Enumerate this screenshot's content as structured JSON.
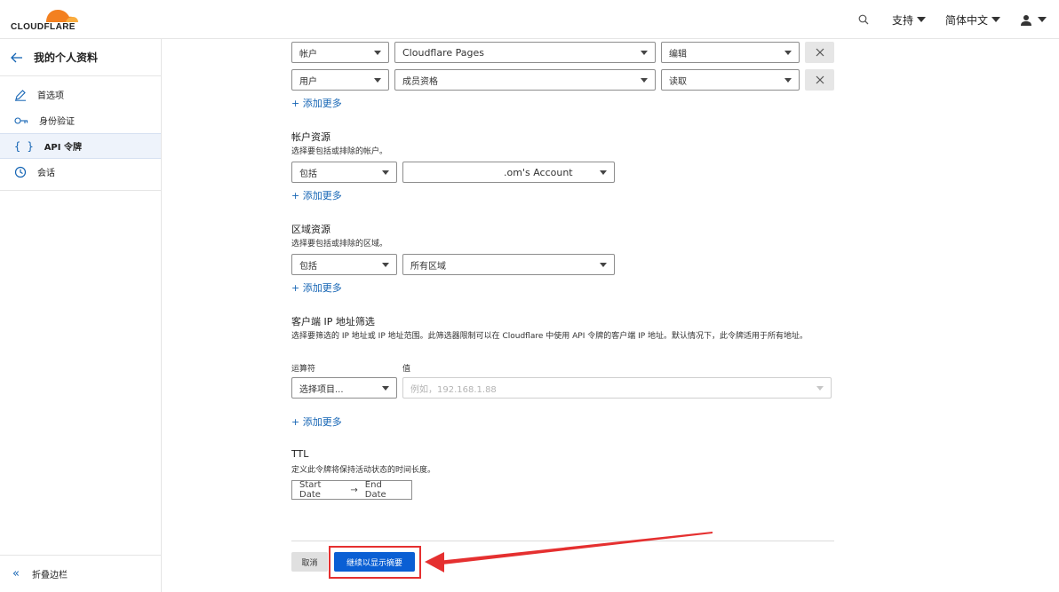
{
  "header": {
    "brand": "CLOUDFLARE",
    "support": "支持",
    "language": "简体中文"
  },
  "sidebar": {
    "title": "我的个人资料",
    "items": [
      {
        "label": "首选项"
      },
      {
        "label": "身份验证"
      },
      {
        "label": "API 令牌"
      },
      {
        "label": "会话"
      }
    ],
    "collapse": "折叠边栏"
  },
  "permissions": {
    "rows": [
      {
        "scope": "帐户",
        "resource": "Cloudflare Pages",
        "level": "编辑"
      },
      {
        "scope": "用户",
        "resource": "成员资格",
        "level": "读取"
      }
    ],
    "add_more": "+ 添加更多"
  },
  "account_resources": {
    "title": "帐户资源",
    "desc": "选择要包括或排除的帐户。",
    "include": "包括",
    "account": ".om's Account",
    "add_more": "+ 添加更多"
  },
  "zone_resources": {
    "title": "区域资源",
    "desc": "选择要包括或排除的区域。",
    "include": "包括",
    "zone": "所有区域",
    "add_more": "+ 添加更多"
  },
  "ip_filter": {
    "title": "客户端 IP 地址筛选",
    "desc": "选择要筛选的 IP 地址或 IP 地址范围。此筛选器限制可以在 Cloudflare 中使用 API 令牌的客户端 IP 地址。默认情况下，此令牌适用于所有地址。",
    "operator_label": "运算符",
    "value_label": "值",
    "operator_placeholder": "选择项目...",
    "value_placeholder": "例如，192.168.1.88",
    "add_more": "+ 添加更多"
  },
  "ttl": {
    "title": "TTL",
    "desc": "定义此令牌将保持活动状态的时间长度。",
    "start": "Start Date",
    "arrow": "→",
    "end": "End Date"
  },
  "actions": {
    "cancel": "取消",
    "continue": "继续以显示摘要"
  },
  "colors": {
    "accent": "#0a5fd4",
    "link": "#1464b4",
    "annotation": "#e53030",
    "logo_orange": "#f38020"
  }
}
